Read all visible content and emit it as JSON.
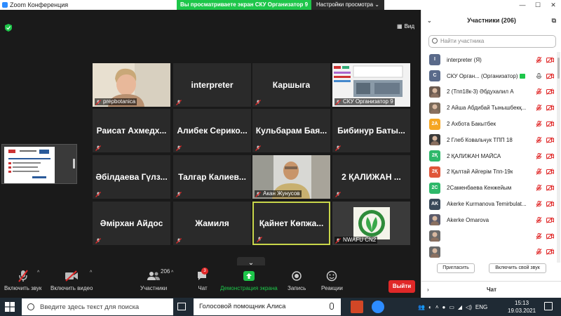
{
  "window": {
    "title": "Zoom Конференция",
    "share_banner": "Вы просматриваете экран СКУ Организатор 9",
    "view_options": "Настройки просмотра",
    "view_button": "Вид",
    "window_controls": [
      "—",
      "☐",
      "✕"
    ]
  },
  "grid": {
    "tiles": [
      {
        "name": "",
        "label": "prepbotanica",
        "kind": "photo"
      },
      {
        "name": "interpreter",
        "label": "",
        "kind": "name"
      },
      {
        "name": "Каршыга",
        "label": "",
        "kind": "name"
      },
      {
        "name": "",
        "label": "СКУ Организатор 9",
        "kind": "screen"
      },
      {
        "name": "Раисат Ахмедх...",
        "label": "",
        "kind": "name"
      },
      {
        "name": "Алибек Серико...",
        "label": "",
        "kind": "name"
      },
      {
        "name": "Кульбарам Бая...",
        "label": "",
        "kind": "name"
      },
      {
        "name": "Бибинур Баты...",
        "label": "",
        "kind": "name"
      },
      {
        "name": "Әбілдаева Гүлз...",
        "label": "",
        "kind": "name"
      },
      {
        "name": "Талгар Калиев...",
        "label": "",
        "kind": "name"
      },
      {
        "name": "",
        "label": "Акан Жунусов",
        "kind": "video"
      },
      {
        "name": "2 ҚАЛИЖАН ...",
        "label": "",
        "kind": "name"
      },
      {
        "name": "Әмірхан Айдос",
        "label": "",
        "kind": "name"
      },
      {
        "name": "Жамиля",
        "label": "",
        "kind": "name"
      },
      {
        "name": "Қайнет Көпжа...",
        "label": "",
        "kind": "name",
        "active": true
      },
      {
        "name": "",
        "label": "NWAFU CN2",
        "kind": "logo"
      }
    ]
  },
  "toolbar": {
    "mute": "Включить звук",
    "video": "Включить видео",
    "participants": "Участники",
    "participants_count": "206",
    "chat": "Чат",
    "chat_badge": "3",
    "share": "Демонстрация экрана",
    "record": "Запись",
    "reactions": "Реакции",
    "leave": "Выйти"
  },
  "panel": {
    "title": "Участники (206)",
    "search_placeholder": "Найти участника",
    "participants": [
      {
        "name": "interpreter (Я)",
        "avatar": "I",
        "color": "#5a6a8a"
      },
      {
        "name": "СКУ Орган... (Организатор)",
        "avatar": "С",
        "color": "#5a6a8a",
        "host": true
      },
      {
        "name": "2 (Тпп18к-3) Әбдухалил А",
        "avatar": "",
        "color": "#6a5a50"
      },
      {
        "name": "2 Айша Абдибай Тынышбекқ...",
        "avatar": "",
        "color": "#7a6a5a"
      },
      {
        "name": "2 Ахбота Бакытбек",
        "avatar": "2A",
        "color": "#f5a623"
      },
      {
        "name": "2 Глеб Ковальчук ТПП 18",
        "avatar": "",
        "color": "#3a3a3a"
      },
      {
        "name": "2 ҚАЛИЖАН МАЙСА",
        "avatar": "2Қ",
        "color": "#2eb86a"
      },
      {
        "name": "2 Қалтай Айгерім Тпп-19к",
        "avatar": "2Қ",
        "color": "#e0563a"
      },
      {
        "name": "2Саменбаева Кенжейым",
        "avatar": "2С",
        "color": "#2eb86a"
      },
      {
        "name": "Akerke Kurmanova Temirbulat...",
        "avatar": "AK",
        "color": "#3a4a5a"
      },
      {
        "name": "Akerke Omarova",
        "avatar": "",
        "color": "#5a5a6a"
      },
      {
        "name": "",
        "avatar": "",
        "color": "#6a6a6a"
      },
      {
        "name": "",
        "avatar": "",
        "color": "#6a6a6a"
      }
    ],
    "invite": "Пригласить",
    "unmute_self": "Включить свой звук",
    "chat": "Чат"
  },
  "taskbar": {
    "search_placeholder": "Введите здесь текст для поиска",
    "cortana": "Голосовой помощник Алиса",
    "lang": "ENG",
    "time": "15:13",
    "date": "19.03.2021"
  },
  "colors": {
    "share_green": "#1ec64a",
    "leave_red": "#e02828",
    "active_border": "#c8d64a",
    "muted_red": "#e02828"
  }
}
